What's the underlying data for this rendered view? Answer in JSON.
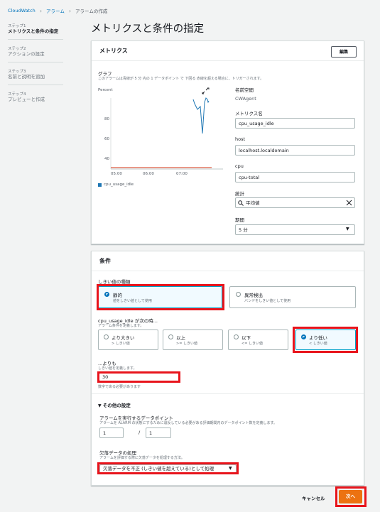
{
  "breadcrumb": {
    "root": "CloudWatch",
    "alarms": "アラーム",
    "current": "アラームの作成"
  },
  "steps": [
    {
      "num": "ステップ1",
      "label": "メトリクスと条件の指定"
    },
    {
      "num": "ステップ2",
      "label": "アクションの設定"
    },
    {
      "num": "ステップ3",
      "label": "名前と説明を追加"
    },
    {
      "num": "ステップ4",
      "label": "プレビューと作成"
    }
  ],
  "page_title": "メトリクスと条件の指定",
  "metrics": {
    "heading": "メトリクス",
    "edit_label": "編集",
    "graph_label": "グラフ",
    "graph_desc": "このアラームは青線が 5 分 内の 1 データポイント で 下回る 赤線を超える場合に、トリガーされます。",
    "graph": {
      "y_axis_title": "Percent",
      "y_ticks": [
        "80",
        "60",
        "40"
      ],
      "x_ticks": [
        "05:00",
        "06:00",
        "07:00"
      ],
      "legend": "cpu_usage_idle",
      "colors": {
        "series": "#1f77b4",
        "threshold": "#d13212"
      }
    },
    "namespace_label": "名前空間",
    "namespace_value": "CWAgent",
    "metric_name_label": "メトリクス名",
    "metric_name_value": "cpu_usage_idle",
    "host_label": "host",
    "host_value": "localhost.localdomain",
    "cpu_label": "cpu",
    "cpu_value": "cpu-total",
    "stat_label": "統計",
    "stat_value": "平均値",
    "period_label": "期間",
    "period_value": "5 分"
  },
  "conditions": {
    "heading": "条件",
    "threshold_type_label": "しきい値の種類",
    "static_label": "静的",
    "static_desc": "値をしきい値として使用",
    "anomaly_label": "異常検出",
    "anomaly_desc": "バンドをしきい値として使用",
    "when_label": "cpu_usage_idle が次の時...",
    "when_desc": "アラーム条件を定義します。",
    "options": [
      {
        "label": "より大きい",
        "desc": "> しきい値"
      },
      {
        "label": "以上",
        "desc": ">= しきい値"
      },
      {
        "label": "以下",
        "desc": "<= しきい値"
      },
      {
        "label": "より低い",
        "desc": "< しきい値"
      }
    ],
    "than_label": "...よりも",
    "than_desc": "しきい値を定義します。",
    "threshold_value": "30",
    "threshold_hint": "数字である必要があります",
    "other_settings": "その他の設定",
    "datapoints_label": "アラームを実行するデータポイント",
    "datapoints_desc": "アラームを ALARM の状態にするために違反している必要がある評価期間内のデータポイント数を定義します。",
    "datapoints_value": "1",
    "datapoints_sep": "/",
    "periods_value": "1",
    "missing_label": "欠落データの処理",
    "missing_desc": "アラームを評価する際に欠落データを処理する方法。",
    "missing_value": "欠落データを不正 (しきい値を超えている)として処理"
  },
  "footer": {
    "cancel": "キャンセル",
    "next": "次へ"
  }
}
